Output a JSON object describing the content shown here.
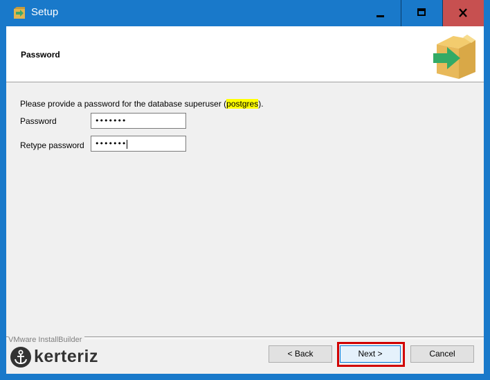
{
  "window": {
    "title": "Setup",
    "colors": {
      "titlebar": "#1979ca",
      "close_hover": "#c75050",
      "highlight": "#ffff00",
      "annotation": "#d10000"
    }
  },
  "titlebar_buttons": {
    "minimize_icon": "minimize-icon",
    "maximize_icon": "maximize-icon",
    "close_icon": "close-icon"
  },
  "header": {
    "title": "Password",
    "logo_icon": "installer-box-arrow-icon"
  },
  "form": {
    "intro_prefix": "Please provide a password for the database superuser (",
    "intro_user": "postgres",
    "intro_suffix": ").",
    "password_label": "Password",
    "password_value": "•••••••",
    "retype_label": "Retype password",
    "retype_value": "•••••••"
  },
  "footer": {
    "builder_label": "VMware InstallBuilder",
    "watermark_text": "kerteriz",
    "back_label": "< Back",
    "next_label": "Next >",
    "cancel_label": "Cancel"
  }
}
